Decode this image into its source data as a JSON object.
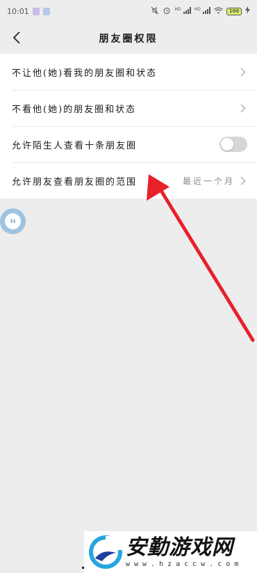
{
  "status_bar": {
    "time": "10:01",
    "network_label_1": "HD",
    "network_label_2": "HD",
    "battery_level": "100",
    "icons": [
      "app-notification-icon",
      "shield-icon",
      "mute-icon",
      "alarm-icon",
      "signal-icon",
      "signal-icon",
      "wifi-icon",
      "battery-icon",
      "charging-icon"
    ]
  },
  "header": {
    "title": "朋友圈权限",
    "back_icon": "chevron-left-icon"
  },
  "settings": {
    "items": [
      {
        "label": "不让他(她)看我的朋友圈和状态",
        "control": "chevron"
      },
      {
        "label": "不看他(她)的朋友圈和状态",
        "control": "chevron"
      },
      {
        "label": "允许陌生人查看十条朋友圈",
        "control": "toggle",
        "enabled": false
      },
      {
        "label": "允许朋友查看朋友圈的范围",
        "value": "最近一个月",
        "control": "chevron"
      }
    ]
  },
  "floating_button": {
    "text": "11"
  },
  "annotation": {
    "arrow_color": "#e8202a"
  },
  "watermark": {
    "title": "安勤游戏网",
    "url": "www.hzaccw.com"
  },
  "colors": {
    "background": "#ededed",
    "card": "#ffffff",
    "secondary_text": "#8a8a8a",
    "toggle_off": "#d6d6d6"
  }
}
